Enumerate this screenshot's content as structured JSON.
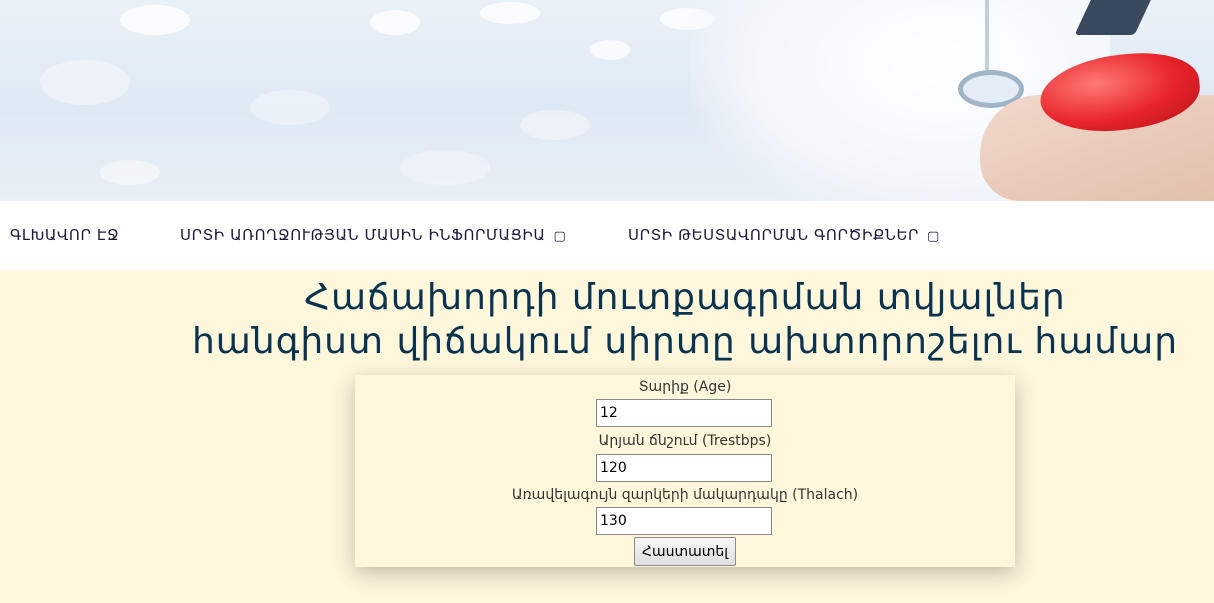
{
  "nav": {
    "items": [
      {
        "label": "ԳԼԽԱՎՈՐ ԷՋ",
        "has_dropdown": false
      },
      {
        "label": "ՍՐՏԻ ԱՌՈՂՋՈՒԹՅԱՆ ՄԱՍԻՆ ԻՆՖՈՐՄԱՑԻԱ",
        "has_dropdown": true
      },
      {
        "label": "ՍՐՏԻ ԹԵՍՏԱՎՈՐՄԱՆ ԳՈՐԾԻՔՆԵՐ",
        "has_dropdown": true
      }
    ],
    "dropdown_glyph": "▢"
  },
  "page": {
    "title_line1": "Հաճախորդի մուտքագրման տվյալներ",
    "title_line2": "հանգիստ վիճակում սիրտը ախտորոշելու համար"
  },
  "form": {
    "age_label": "Տարիք (Age)",
    "age_value": "12",
    "trestbps_label": "Արյան ճնշում (Trestbps)",
    "trestbps_value": "120",
    "thalach_label": "Առավելագույն զարկերի մակարդակը (Thalach)",
    "thalach_value": "130",
    "submit_label": "Հաստատել"
  },
  "colors": {
    "page_background": "#fff7dc",
    "title_color": "#0a3350",
    "nav_background": "#ffffff"
  }
}
